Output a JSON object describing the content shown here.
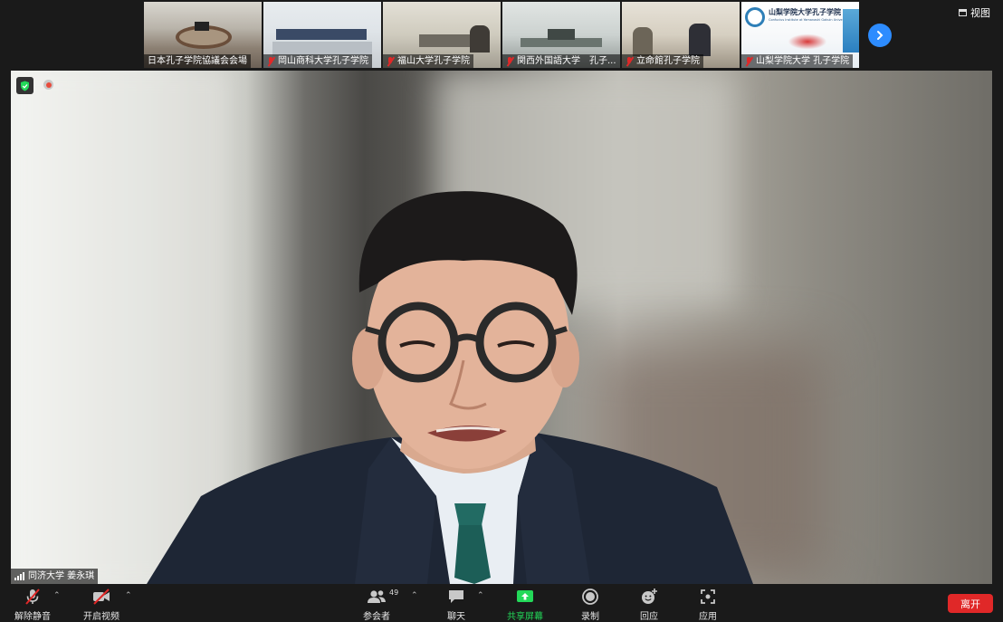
{
  "header": {
    "view_label": "视图"
  },
  "gallery": [
    {
      "caption": "日本孔子学院協議会会場",
      "muted": false
    },
    {
      "caption": "岡山商科大学孔子学院",
      "muted": true
    },
    {
      "caption": "福山大学孔子学院",
      "muted": true
    },
    {
      "caption": "関西外国語大学　孔子...",
      "muted": true
    },
    {
      "caption": "立命館孔子学院",
      "muted": true
    },
    {
      "caption": "山梨学院大学 孔子学院",
      "muted": true
    }
  ],
  "logo_thumb": {
    "title": "山梨学院大学孔子学院",
    "subtitle": "Confucius Institute at Yamanashi Gakuin University"
  },
  "main": {
    "speaker_name": "同济大学 姜永琪"
  },
  "toolbar": {
    "unmute_label": "解除静音",
    "start_video_label": "开启视频",
    "participants_label": "参会者",
    "participants_count": "49",
    "chat_label": "聊天",
    "share_label": "共享屏幕",
    "record_label": "录制",
    "reactions_label": "回应",
    "apps_label": "应用",
    "leave_label": "离开"
  },
  "colors": {
    "accent": "#2d8cff",
    "share": "#23d959",
    "leave": "#e02828"
  }
}
